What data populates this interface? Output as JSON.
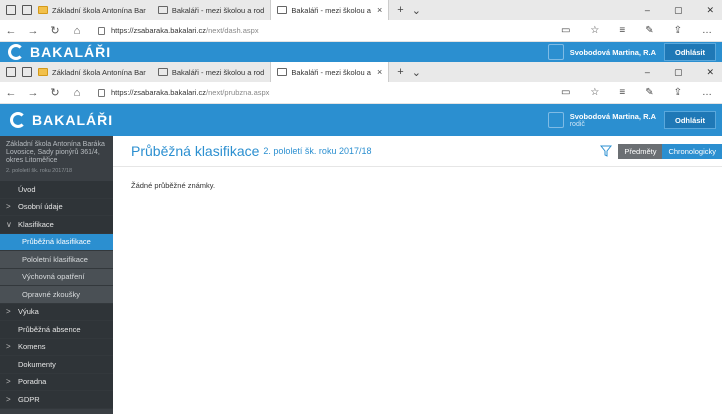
{
  "browser_bg": {
    "tabs": [
      {
        "label": "Základní škola Antonína Bar",
        "active": false
      },
      {
        "label": "Bakaláři - mezi školou a rod",
        "active": false
      },
      {
        "label": "Bakaláři - mezi školou a",
        "active": true
      }
    ],
    "url_host": "https://zsabaraka.bakalari.cz",
    "url_path": "/next/dash.aspx"
  },
  "browser_fg": {
    "tabs": [
      {
        "label": "Základní škola Antonína Bar",
        "active": false
      },
      {
        "label": "Bakaláři - mezi školou a rod",
        "active": false
      },
      {
        "label": "Bakaláři - mezi školou a",
        "active": true
      }
    ],
    "url_host": "https://zsabaraka.bakalari.cz",
    "url_path": "/next/prubzna.aspx"
  },
  "app": {
    "brand": "BAKALÁŘI",
    "user_name": "Svobodová Martina, R.A",
    "user_role": "rodič",
    "logout_label": "Odhlásit",
    "brand_color": "#2b8fd0"
  },
  "sidebar": {
    "school_name": "Základní škola Antonína Baráka Lovosice, Sady pionýrů 361/4, okres Litoměřice",
    "period": "2. pololetí šk. roku 2017/18",
    "items": [
      {
        "label": "Úvod",
        "type": "top",
        "arrow": ""
      },
      {
        "label": "Osobní údaje",
        "type": "top",
        "arrow": ">"
      },
      {
        "label": "Klasifikace",
        "type": "top",
        "arrow": "v"
      },
      {
        "label": "Průběžná klasifikace",
        "type": "sub",
        "active": true
      },
      {
        "label": "Pololetní klasifikace",
        "type": "sub"
      },
      {
        "label": "Výchovná opatření",
        "type": "sub"
      },
      {
        "label": "Opravné zkoušky",
        "type": "sub"
      },
      {
        "label": "Výuka",
        "type": "top",
        "arrow": ">"
      },
      {
        "label": "Průběžná absence",
        "type": "top",
        "arrow": ""
      },
      {
        "label": "Komens",
        "type": "top",
        "arrow": ">"
      },
      {
        "label": "Dokumenty",
        "type": "top",
        "arrow": ""
      },
      {
        "label": "Poradna",
        "type": "top",
        "arrow": ">"
      },
      {
        "label": "GDPR",
        "type": "top",
        "arrow": ">"
      }
    ]
  },
  "content": {
    "title": "Průběžná klasifikace",
    "subtitle": "2. pololetí šk. roku 2017/18",
    "toggle_subjects": "Předměty",
    "toggle_chrono": "Chronologicky",
    "empty_message": "Žádné průběžné známky."
  }
}
